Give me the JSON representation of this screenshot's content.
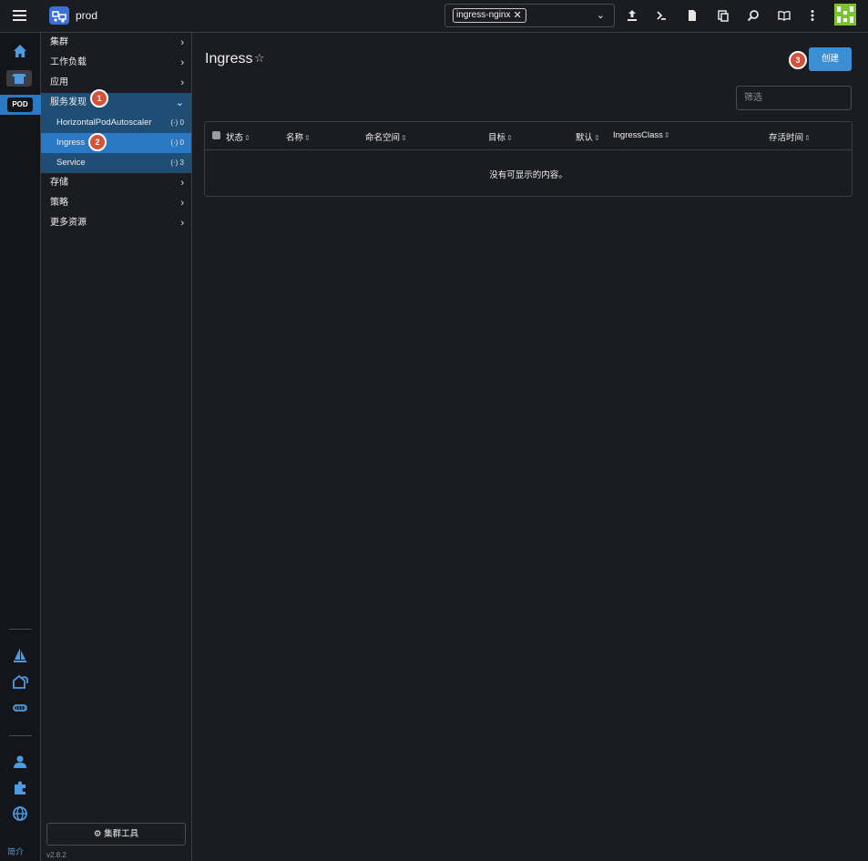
{
  "header": {
    "cluster_name": "prod",
    "namespace_chip": "ingress-nginx",
    "icons": [
      "upload-icon",
      "terminal-icon",
      "file-icon",
      "copy-icon",
      "search-icon",
      "book-icon",
      "more-icon"
    ]
  },
  "rail": {
    "pod_label": "POD",
    "about": "简介"
  },
  "sidebar": {
    "items": [
      {
        "label": "集群"
      },
      {
        "label": "工作负载"
      },
      {
        "label": "应用"
      },
      {
        "label": "服务发现"
      },
      {
        "label": "存储"
      },
      {
        "label": "策略"
      },
      {
        "label": "更多资源"
      }
    ],
    "sub_items": [
      {
        "label": "HorizontalPodAutoscaler",
        "count": "0"
      },
      {
        "label": "Ingress",
        "count": "0"
      },
      {
        "label": "Service",
        "count": "3"
      }
    ],
    "tools_label": "集群工具",
    "version": "v2.8.2"
  },
  "steps": [
    "1",
    "2",
    "3"
  ],
  "main": {
    "title": "Ingress",
    "create_label": "创建",
    "filter_placeholder": "筛选",
    "columns": [
      "状态",
      "名称",
      "命名空间",
      "目标",
      "默认",
      "IngressClass",
      "存活时间"
    ],
    "empty_text": "没有可显示的内容。"
  },
  "colors": {
    "accent": "#2a79c4",
    "open_group": "#1f4d74",
    "step_badge": "#d4513a",
    "create_button": "#3d8fd4"
  }
}
